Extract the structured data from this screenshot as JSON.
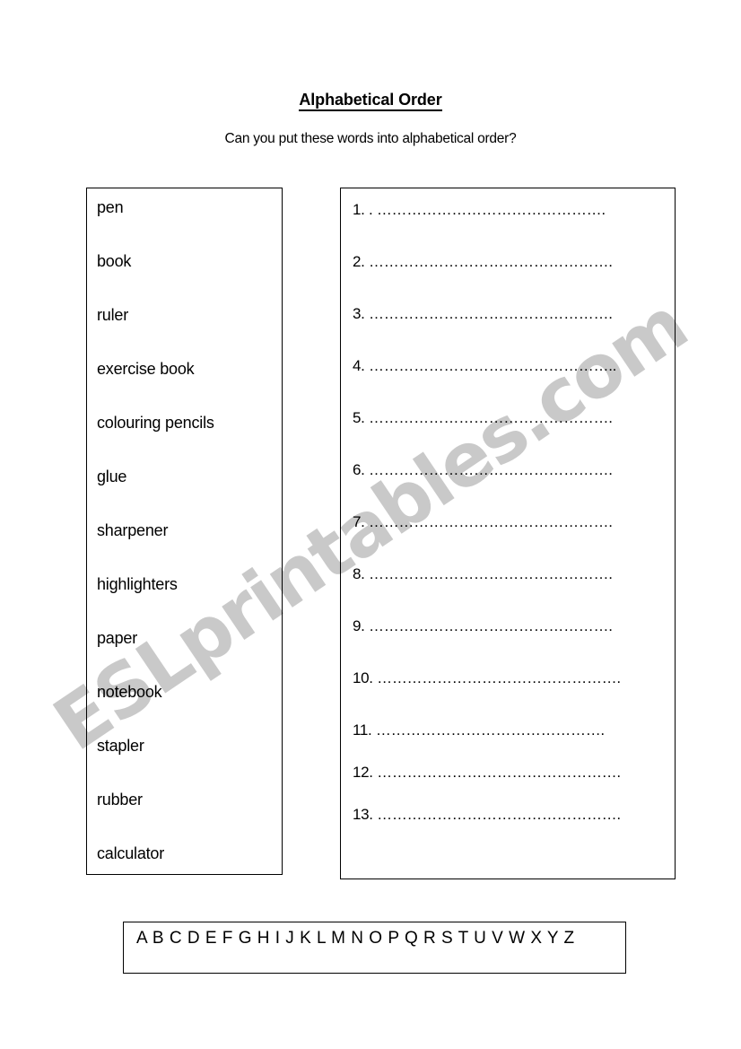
{
  "document": {
    "title": "Alphabetical Order",
    "instruction": "Can you put these words into alphabetical order?",
    "watermark": "ESLprintables.com",
    "colors": {
      "text": "#000000",
      "border": "#000000",
      "watermark": "#c9c9c9",
      "background": "#ffffff"
    }
  },
  "word_box": {
    "words": [
      "pen",
      "book",
      "ruler",
      "exercise book",
      "colouring pencils",
      "glue",
      "sharpener",
      "highlighters",
      "paper",
      "notebook",
      "stapler",
      "rubber",
      "calculator"
    ]
  },
  "answer_box": {
    "lines": [
      "1. . ……………………………………….",
      "2. ………………………………………….",
      "3. ………………………………………….",
      "4. …………………………………………..",
      "5. ………………………………………….",
      "6. ………………………………………….",
      "7. ………………………………………….",
      "8. ………………………………………….",
      "9. ………………………………………….",
      "10. ………………………………………….",
      "11. ……………………………………….",
      "12. ………………………………………….",
      "13. …………………………………………."
    ]
  },
  "alphabet_box": {
    "letters": "A B C D E F G H I J K L M N O P Q R S T U V W X Y Z"
  }
}
